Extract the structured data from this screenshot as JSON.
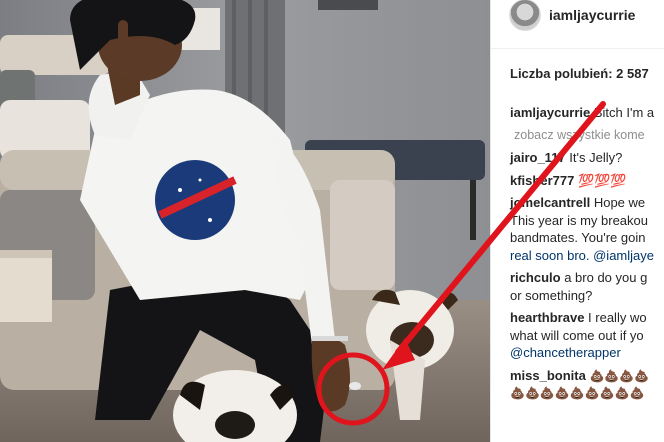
{
  "post": {
    "username": "iamljaycurrie",
    "likes_label": "Liczba polubień: 2 587"
  },
  "comments": {
    "view_all": "zobacz wszystkie kome",
    "items": [
      {
        "user": "iamljaycurrie",
        "lines": [
          "Bitch I'm a"
        ]
      },
      {
        "user": "jairo_117",
        "lines": [
          "It's Jelly?"
        ]
      },
      {
        "user": "kfisher777",
        "lines": [
          "💯💯💯"
        ]
      },
      {
        "user": "jomelcantrell",
        "lines": [
          "Hope we",
          "This year is my breakou",
          "bandmates. You're goin",
          "real soon bro. @iamljaye"
        ]
      },
      {
        "user": "richculo",
        "lines": [
          "a bro do you g",
          "or something?"
        ]
      },
      {
        "user": "hearthbrave",
        "lines": [
          "I really wo",
          "what will come out if yo",
          "@chancetherapper"
        ]
      },
      {
        "user": "miss_bonita",
        "lines": [
          "💩💩💩💩",
          "💩💩💩💩💩💩💩💩💩"
        ]
      }
    ]
  },
  "photo": {
    "shirt_logo": "NASA",
    "annotation_color": "#e0141c"
  }
}
